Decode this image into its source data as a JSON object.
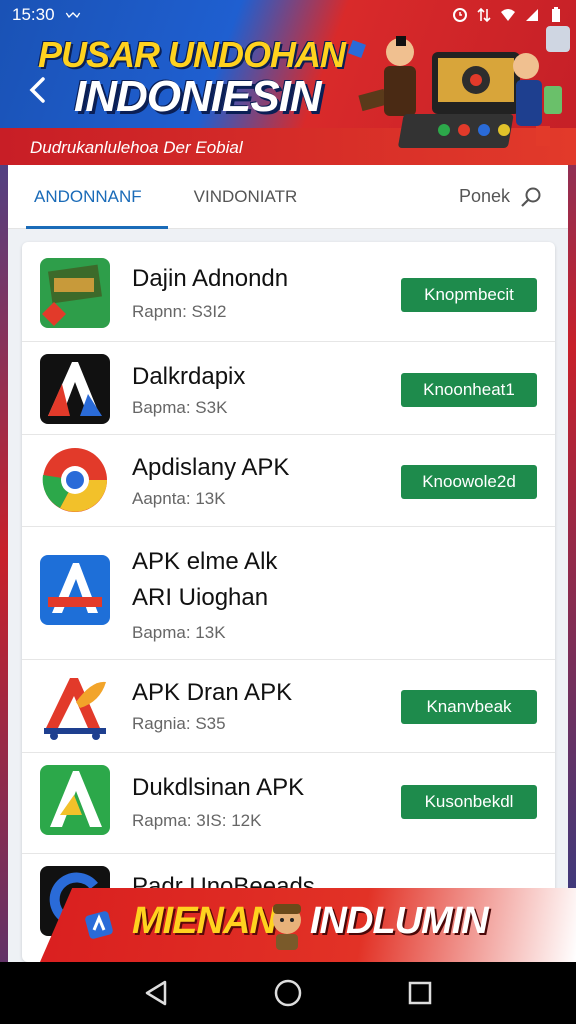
{
  "status_bar": {
    "time": "15:30"
  },
  "hero": {
    "title_line1": "PUSAR UNDOHAN",
    "title_line2": "INDONIESIN",
    "subtitle": "Dudrukanlulehoa Der Eobial"
  },
  "tabs": [
    {
      "label": "ANDONNANF",
      "active": true
    },
    {
      "label": "VINDONIATR",
      "active": false
    }
  ],
  "search": {
    "label": "Ponek"
  },
  "apps": [
    {
      "name": "Dajin Adnondn",
      "meta": "Rapnn: S3I2",
      "button": "Knopmbecit"
    },
    {
      "name": "Dalkrdapix",
      "meta": "Bapma: S3K",
      "button": "Knoonheat1"
    },
    {
      "name": "Apdislany APK",
      "meta": "Aapnta: 13K",
      "button": "Knoowole2d"
    },
    {
      "name": "APK elme Alk",
      "name2": "ARI Uioghan",
      "meta": "Bapma: 13K",
      "button": ""
    },
    {
      "name": "APK Dran APK",
      "meta": "Ragnia: S35",
      "button": "Knanvbeak"
    },
    {
      "name": "Dukdlsinan APK",
      "meta": "Rapma: 3IS: 12K",
      "button": "Kusonbekdl"
    },
    {
      "name": "Padr UnoBeeads",
      "meta": "",
      "button": ""
    }
  ],
  "promo": {
    "text1": "MIENAN",
    "text2": "INDLUMIN"
  },
  "colors": {
    "accent_blue": "#1a6bb8",
    "button_green": "#1e8b4c",
    "hero_red": "#c8202a",
    "hero_blue": "#1a52b5"
  }
}
